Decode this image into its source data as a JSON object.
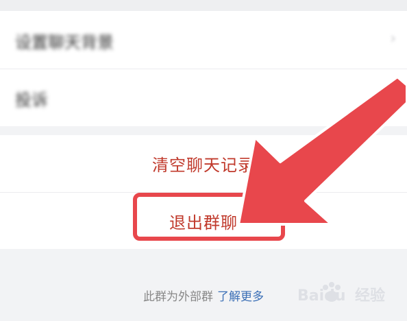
{
  "settings": {
    "items": [
      {
        "label": "设置聊天背景",
        "chevron": "›"
      },
      {
        "label": "投诉",
        "chevron": "›"
      }
    ]
  },
  "actions": {
    "clear_history": "清空聊天记录",
    "exit_group": "退出群聊"
  },
  "footer": {
    "note": "此群为外部群",
    "learn_more": "了解更多"
  },
  "watermark": {
    "brand": "Baidu",
    "suffix": "经验"
  },
  "annotation": {
    "arrow_color": "#e8474c",
    "box_color": "#e8474c",
    "arrow_icon": "pointer-arrow-icon"
  },
  "colors": {
    "danger_text": "#c0392b",
    "link": "#3b6fb6"
  }
}
